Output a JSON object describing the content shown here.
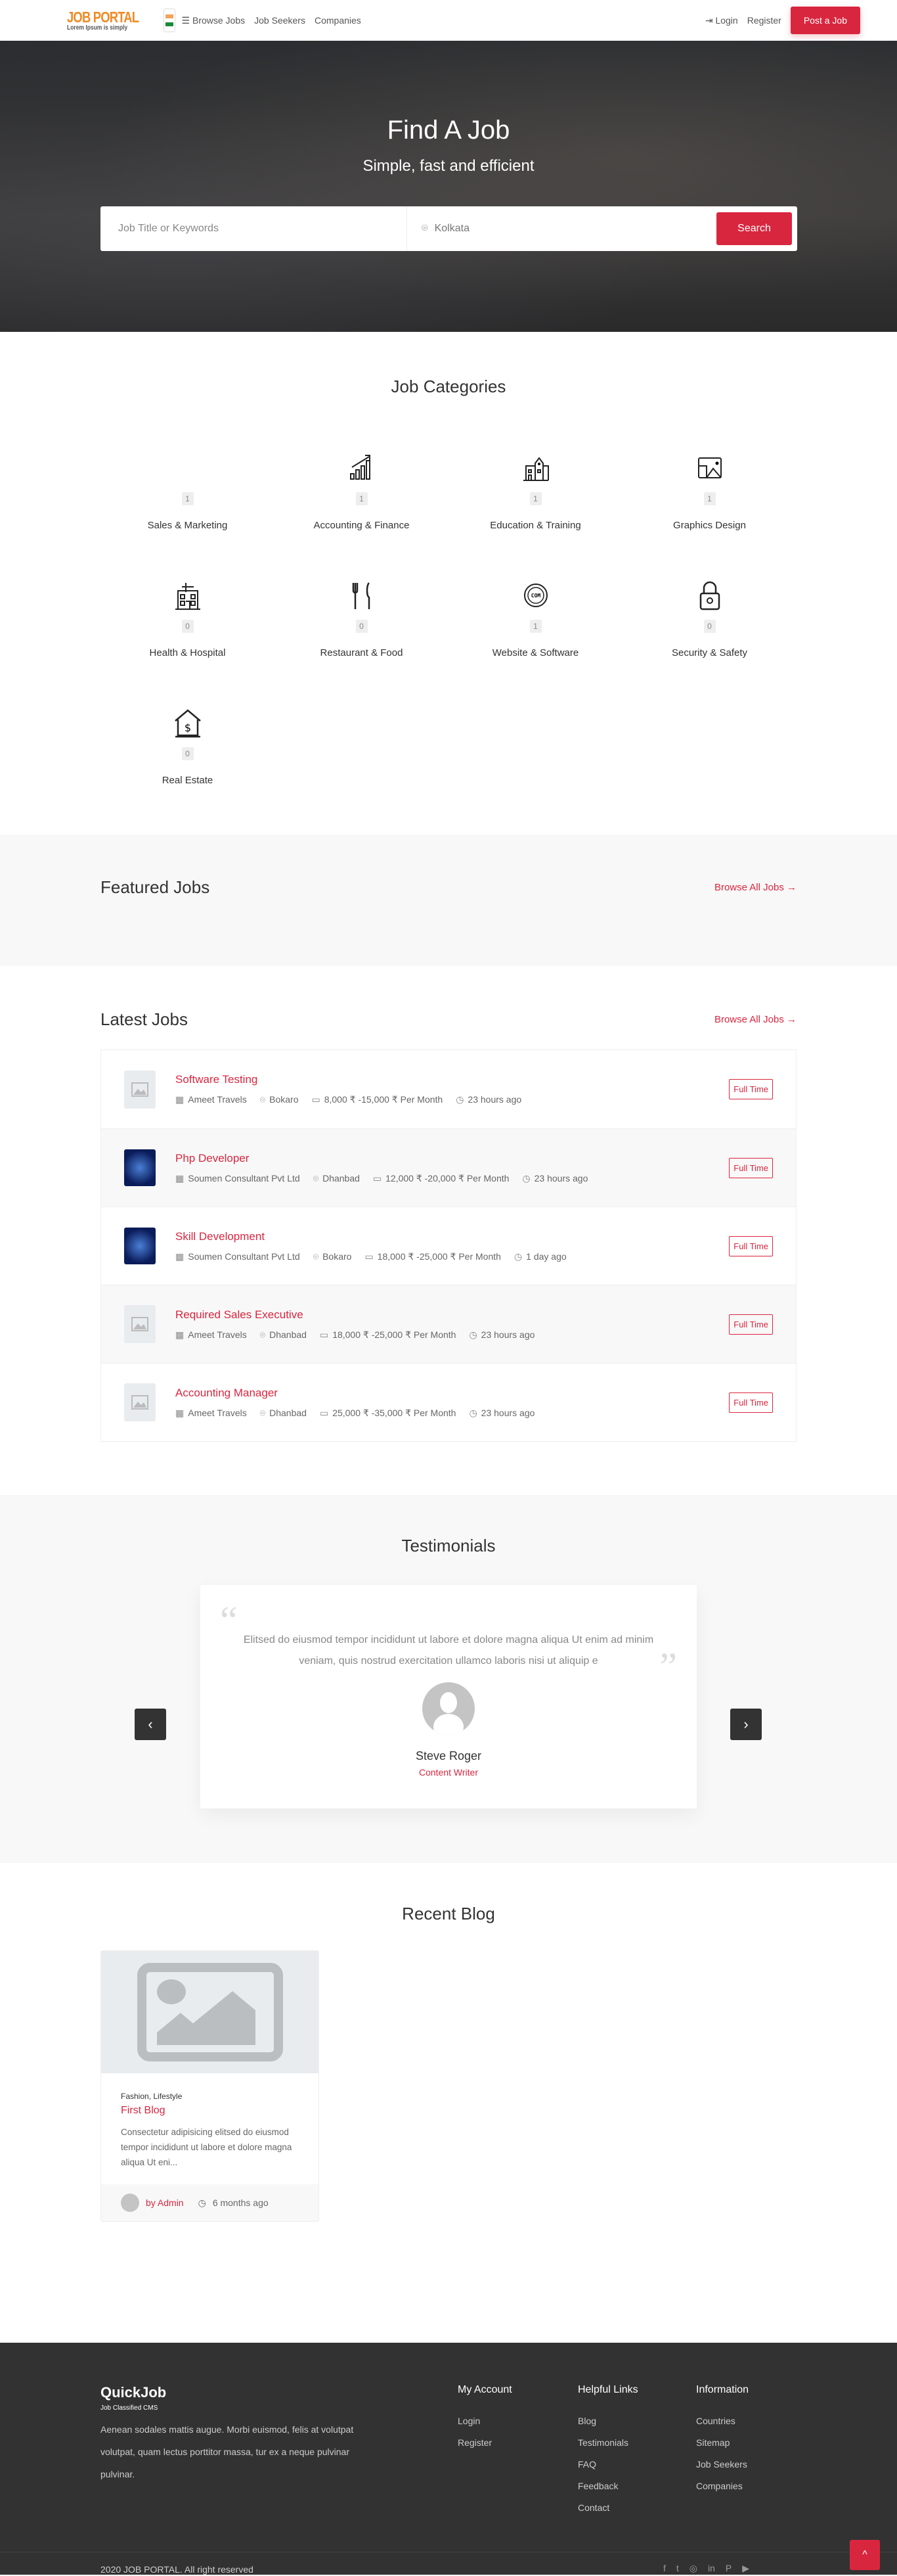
{
  "header": {
    "logo_title": "JOB PORTAL",
    "logo_tagline": "Lorem Ipsum is simply",
    "nav": [
      "Browse Jobs",
      "Job Seekers",
      "Companies"
    ],
    "login": "Login",
    "register": "Register",
    "post_job": "Post a Job"
  },
  "hero": {
    "title": "Find A Job",
    "subtitle": "Simple, fast and efficient",
    "keyword_placeholder": "Job Title or Keywords",
    "location_value": "Kolkata",
    "search": "Search"
  },
  "categories": {
    "title": "Job Categories",
    "items": [
      {
        "label": "Sales & Marketing",
        "count": "1",
        "icon": "none"
      },
      {
        "label": "Accounting & Finance",
        "count": "1",
        "icon": "chart-growth-icon"
      },
      {
        "label": "Education & Training",
        "count": "1",
        "icon": "school-building-icon"
      },
      {
        "label": "Graphics Design",
        "count": "1",
        "icon": "image-gallery-icon"
      },
      {
        "label": "Health & Hospital",
        "count": "0",
        "icon": "hospital-icon"
      },
      {
        "label": "Restaurant & Food",
        "count": "0",
        "icon": "fork-knife-icon"
      },
      {
        "label": "Website & Software",
        "count": "1",
        "icon": "globe-com-icon"
      },
      {
        "label": "Security & Safety",
        "count": "0",
        "icon": "padlock-icon"
      },
      {
        "label": "Real Estate",
        "count": "0",
        "icon": "house-dollar-icon"
      }
    ]
  },
  "featured": {
    "title": "Featured Jobs",
    "browse": "Browse All Jobs"
  },
  "latest": {
    "title": "Latest Jobs",
    "browse": "Browse All Jobs",
    "jobs": [
      {
        "title": "Software Testing",
        "company": "Ameet Travels",
        "location": "Bokaro",
        "salary": "8,000 ₹ -15,000 ₹ Per Month",
        "time": "23 hours ago",
        "type": "Full Time",
        "logo": "placeholder"
      },
      {
        "title": "Php Developer",
        "company": "Soumen Consultant Pvt Ltd",
        "location": "Dhanbad",
        "salary": "12,000 ₹ -20,000 ₹ Per Month",
        "time": "23 hours ago",
        "type": "Full Time",
        "logo": "company"
      },
      {
        "title": "Skill Development",
        "company": "Soumen Consultant Pvt Ltd",
        "location": "Bokaro",
        "salary": "18,000 ₹ -25,000 ₹ Per Month",
        "time": "1 day ago",
        "type": "Full Time",
        "logo": "company"
      },
      {
        "title": "Required Sales Executive",
        "company": "Ameet Travels",
        "location": "Dhanbad",
        "salary": "18,000 ₹ -25,000 ₹ Per Month",
        "time": "23 hours ago",
        "type": "Full Time",
        "logo": "placeholder"
      },
      {
        "title": "Accounting Manager",
        "company": "Ameet Travels",
        "location": "Dhanbad",
        "salary": "25,000 ₹ -35,000 ₹ Per Month",
        "time": "23 hours ago",
        "type": "Full Time",
        "logo": "placeholder"
      }
    ]
  },
  "testimonials": {
    "title": "Testimonials",
    "text": "Elitsed do eiusmod tempor incididunt ut labore et dolore magna aliqua Ut enim ad minim veniam, quis nostrud exercitation ullamco laboris nisi ut aliquip e",
    "name": "Steve Roger",
    "role": "Content Writer"
  },
  "blog": {
    "title": "Recent Blog",
    "post": {
      "categories": "Fashion, Lifestyle",
      "title": "First Blog",
      "excerpt": "Consectetur adipisicing elitsed do eiusmod tempor incididunt ut labore et dolore magna aliqua Ut eni...",
      "author": "by Admin",
      "time": "6 months ago"
    }
  },
  "footer": {
    "logo_title": "QuickJob",
    "logo_tagline": "Job Classified CMS",
    "description": "Aenean sodales mattis augue. Morbi euismod, felis at volutpat volutpat, quam lectus porttitor massa, tur ex a neque pulvinar pulvinar.",
    "columns": [
      {
        "title": "My Account",
        "links": [
          "Login",
          "Register"
        ]
      },
      {
        "title": "Helpful Links",
        "links": [
          "Blog",
          "Testimonials",
          "FAQ",
          "Feedback",
          "Contact"
        ]
      },
      {
        "title": "Information",
        "links": [
          "Countries",
          "Sitemap",
          "Job Seekers",
          "Companies"
        ]
      }
    ],
    "copyright": "2020 JOB PORTAL. All right reserved",
    "social": [
      "facebook",
      "twitter",
      "instagram",
      "linkedin",
      "pinterest",
      "youtube"
    ]
  },
  "colors": {
    "accent": "#d9263f",
    "logo": "#f08a24",
    "footer_bg": "#323232"
  }
}
